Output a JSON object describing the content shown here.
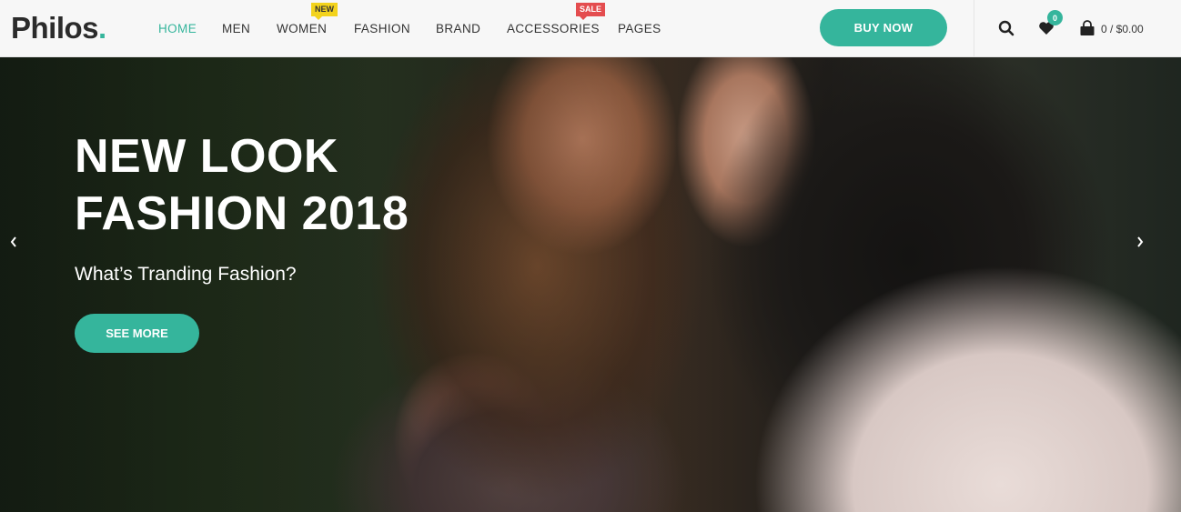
{
  "brand": {
    "name": "Philos",
    "dot": "."
  },
  "nav": {
    "items": [
      {
        "label": "HOME",
        "active": true
      },
      {
        "label": "MEN"
      },
      {
        "label": "WOMEN",
        "badge": "NEW"
      },
      {
        "label": "FASHION"
      },
      {
        "label": "BRAND"
      },
      {
        "label": "ACCESSORIES",
        "badge": "SALE"
      },
      {
        "label": "PAGES"
      }
    ]
  },
  "header": {
    "buy_label": "BUY NOW",
    "wishlist_count": "0",
    "cart_summary": "0 / $0.00"
  },
  "hero": {
    "title_line1": "NEW LOOK",
    "title_line2": "FASHION 2018",
    "subtitle": "What’s Tranding Fashion?",
    "cta_label": "SEE MORE"
  },
  "colors": {
    "accent": "#35b59c",
    "badge_new": "#f3d31c",
    "badge_sale": "#e44d4f",
    "text": "#333333"
  },
  "icons": [
    "search-icon",
    "heart-icon",
    "cart-icon",
    "chevron-left-icon",
    "chevron-right-icon"
  ]
}
